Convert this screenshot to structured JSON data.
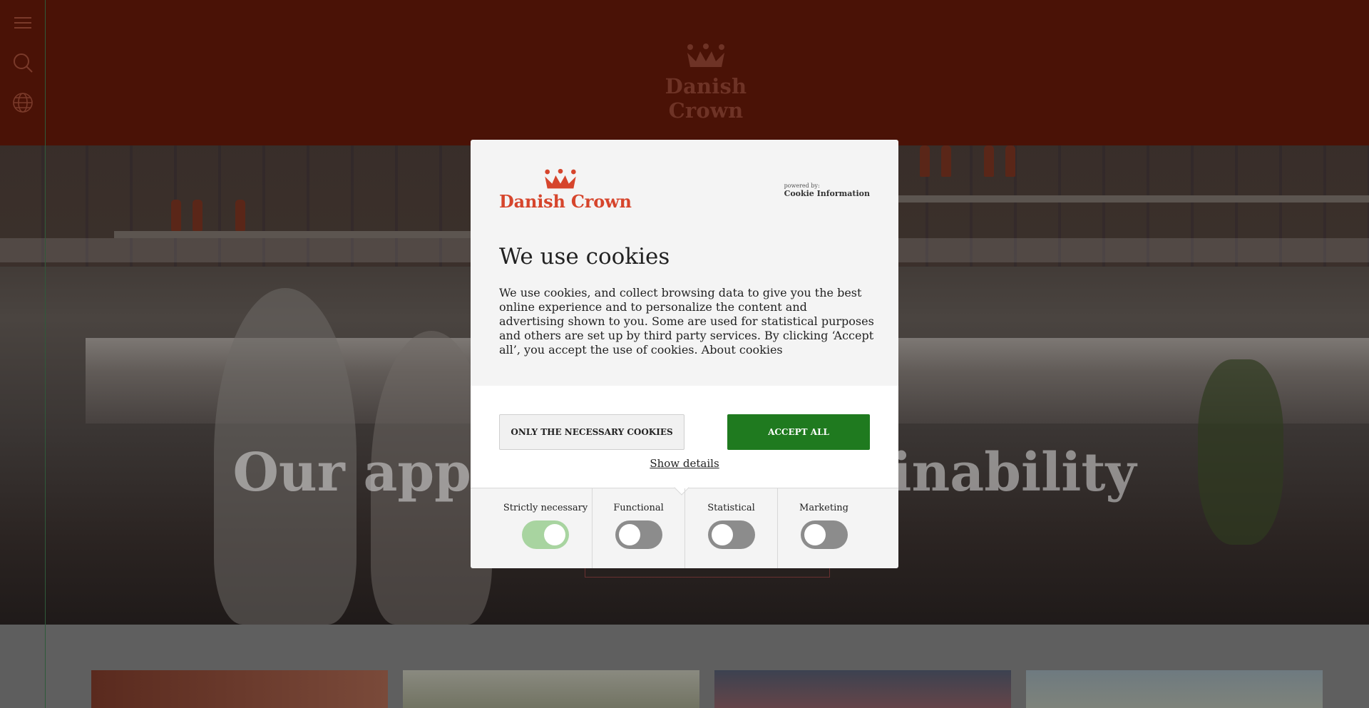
{
  "header": {
    "logo_text": "Danish Crown",
    "icons": [
      "menu-icon",
      "search-icon",
      "globe-icon"
    ]
  },
  "hero": {
    "title": "Our approach to sustainability"
  },
  "cookie_dialog": {
    "logo_text": "Danish Crown",
    "powered_by_label": "powered by:",
    "powered_by_name": "Cookie Information",
    "title": "We use cookies",
    "body": "We use cookies, and collect browsing data to give you the best online experience and to personalize the content and advertising shown to you. Some are used for statistical purposes and others are set up by third party services. By clicking ‘Accept all’, you accept the use of cookies. About cookies",
    "only_necessary_label": "ONLY THE NECESSARY COOKIES",
    "accept_all_label": "ACCEPT ALL",
    "show_details_label": "Show details",
    "categories": [
      {
        "label": "Strictly necessary",
        "enabled": true
      },
      {
        "label": "Functional",
        "enabled": false
      },
      {
        "label": "Statistical",
        "enabled": false
      },
      {
        "label": "Marketing",
        "enabled": false
      }
    ],
    "colors": {
      "brand_red": "#d6452c",
      "accept_green": "#1f7a1f",
      "toggle_on": "#a8d4a0",
      "toggle_off": "#8c8c8c",
      "header_bg": "#4a1206"
    }
  }
}
